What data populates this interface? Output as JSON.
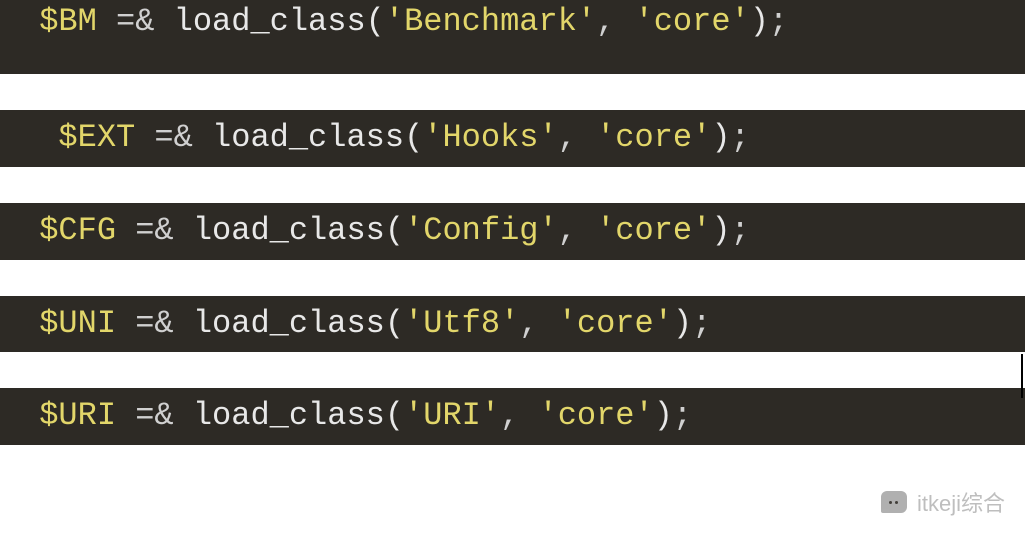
{
  "lines": [
    {
      "var": "$BM",
      "op": " =& ",
      "fn": "load_class",
      "open": "(",
      "arg1": "'Benchmark'",
      "comma": ", ",
      "arg2": "'core'",
      "close": ")",
      "semi": ";",
      "lead": " "
    },
    {
      "var": "$EXT",
      "op": " =& ",
      "fn": "load_class",
      "open": "(",
      "arg1": "'Hooks'",
      "comma": ", ",
      "arg2": "'core'",
      "close": ")",
      "semi": ";",
      "lead": "  "
    },
    {
      "var": "$CFG",
      "op": " =& ",
      "fn": "load_class",
      "open": "(",
      "arg1": "'Config'",
      "comma": ", ",
      "arg2": "'core'",
      "close": ")",
      "semi": ";",
      "lead": " "
    },
    {
      "var": "$UNI",
      "op": " =& ",
      "fn": "load_class",
      "open": "(",
      "arg1": "'Utf8'",
      "comma": ", ",
      "arg2": "'core'",
      "close": ")",
      "semi": ";",
      "lead": " "
    },
    {
      "var": "$URI",
      "op": " =& ",
      "fn": "load_class",
      "open": "(",
      "arg1": "'URI'",
      "comma": ", ",
      "arg2": "'core'",
      "close": ")",
      "semi": ";",
      "lead": " "
    }
  ],
  "watermark": {
    "label": "itkeji综合"
  }
}
